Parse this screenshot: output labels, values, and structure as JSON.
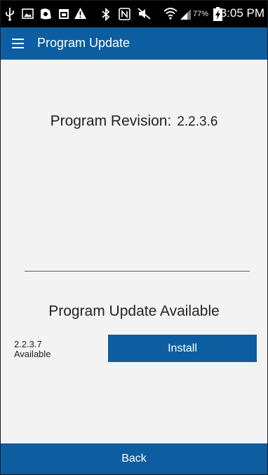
{
  "status_bar": {
    "battery_percent": "77%",
    "time": "3:05 PM",
    "icons": [
      "usb-icon",
      "image-icon",
      "app-icon",
      "calendar-icon",
      "warning-icon",
      "bluetooth-icon",
      "nfc-icon",
      "mute-icon",
      "wifi-icon",
      "signal-icon",
      "battery-charging-icon"
    ]
  },
  "app_bar": {
    "title": "Program Update",
    "menu_icon": "hamburger-menu-icon"
  },
  "main": {
    "revision_label": "Program Revision:",
    "revision_value": "2.2.3.6",
    "update_heading": "Program Update Available",
    "update_version": "2.2.3.7",
    "update_status": "Available",
    "install_label": "Install"
  },
  "footer": {
    "back_label": "Back"
  },
  "colors": {
    "accent": "#0c5ea0",
    "background": "#f3f3f3",
    "status_bar": "#000000",
    "text": "#222222"
  }
}
